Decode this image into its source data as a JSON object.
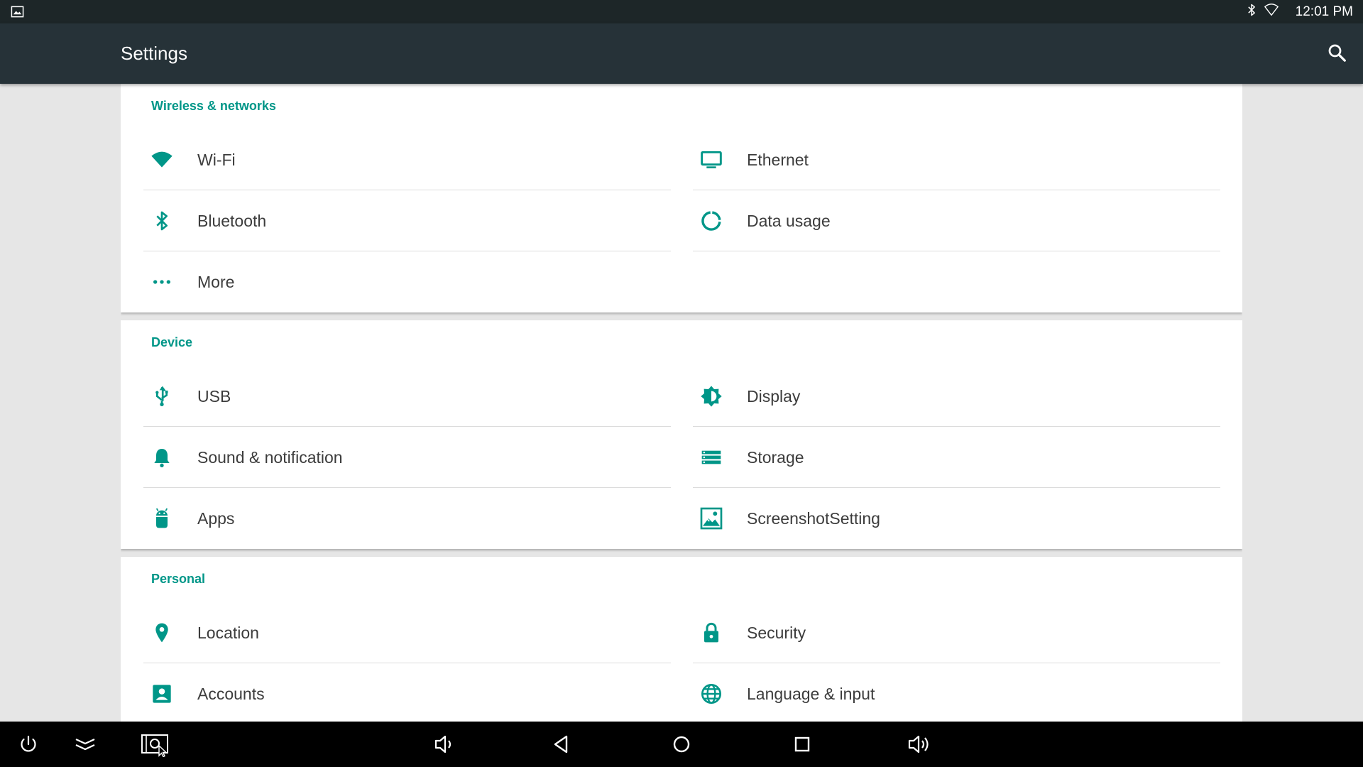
{
  "status": {
    "time": "12:01 PM",
    "left_icon": "image-notification-icon",
    "right_icons": [
      "bluetooth-icon",
      "wifi-empty-icon"
    ]
  },
  "appbar": {
    "title": "Settings",
    "search_icon": "search-icon"
  },
  "accent_color": "#009688",
  "sections": [
    {
      "title": "Wireless & networks",
      "items": [
        {
          "label": "Wi-Fi",
          "icon": "wifi-icon"
        },
        {
          "label": "Ethernet",
          "icon": "monitor-icon"
        },
        {
          "label": "Bluetooth",
          "icon": "bluetooth-icon"
        },
        {
          "label": "Data usage",
          "icon": "data-usage-icon"
        },
        {
          "label": "More",
          "icon": "more-icon"
        }
      ]
    },
    {
      "title": "Device",
      "items": [
        {
          "label": "USB",
          "icon": "usb-icon"
        },
        {
          "label": "Display",
          "icon": "brightness-icon"
        },
        {
          "label": "Sound & notification",
          "icon": "bell-icon"
        },
        {
          "label": "Storage",
          "icon": "storage-icon"
        },
        {
          "label": "Apps",
          "icon": "android-icon"
        },
        {
          "label": "ScreenshotSetting",
          "icon": "screenshot-icon"
        }
      ]
    },
    {
      "title": "Personal",
      "items": [
        {
          "label": "Location",
          "icon": "location-pin-icon"
        },
        {
          "label": "Security",
          "icon": "lock-icon"
        },
        {
          "label": "Accounts",
          "icon": "account-box-icon"
        },
        {
          "label": "Language & input",
          "icon": "globe-icon"
        }
      ]
    }
  ],
  "navbar": [
    {
      "name": "power-icon"
    },
    {
      "name": "collapse-chevrons-icon"
    },
    {
      "name": "screenshot-capture-icon"
    },
    {
      "name": "volume-down-icon"
    },
    {
      "name": "back-icon"
    },
    {
      "name": "home-icon"
    },
    {
      "name": "recents-icon"
    },
    {
      "name": "volume-up-icon"
    }
  ]
}
